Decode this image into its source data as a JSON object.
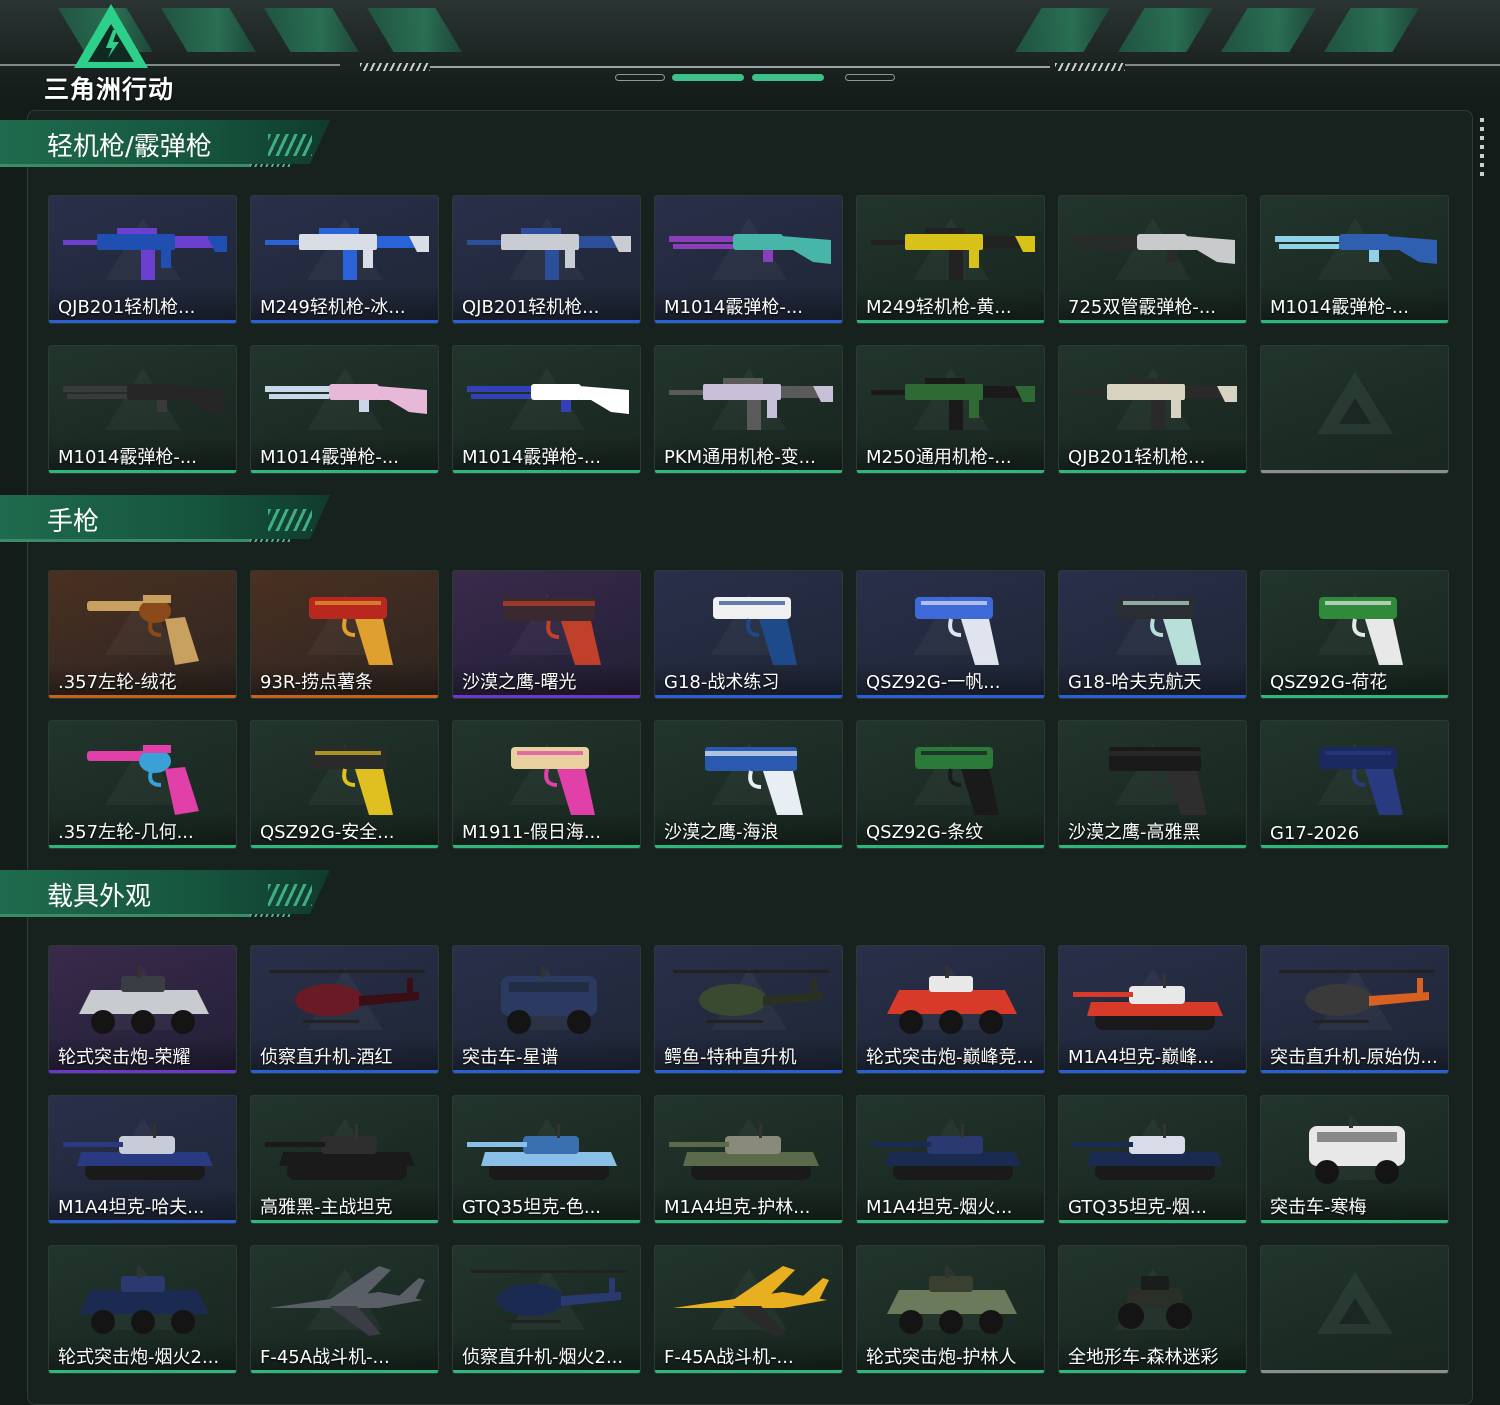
{
  "app": {
    "logo_text": "三角洲行动"
  },
  "colors": {
    "green": "#2fb67a",
    "blue": "#2a5fd6",
    "purple": "#6b38c9",
    "orange": "#c8621c",
    "gray": "#8a8f8d"
  },
  "sections": [
    {
      "title": "轻机枪/霰弹枪",
      "items": [
        {
          "name": "QJB201轻机枪...",
          "rarity": "blue",
          "bg": "blue",
          "kind": "lmg",
          "c1": "#1f4fb0",
          "c2": "#6b3fd0"
        },
        {
          "name": "M249轻机枪-冰...",
          "rarity": "blue",
          "bg": "blue",
          "kind": "lmg",
          "c1": "#d8dde6",
          "c2": "#2a62d8"
        },
        {
          "name": "QJB201轻机枪...",
          "rarity": "blue",
          "bg": "blue",
          "kind": "lmg",
          "c1": "#c9cdd3",
          "c2": "#2d4f9a"
        },
        {
          "name": "M1014霰弹枪-...",
          "rarity": "blue",
          "bg": "blue",
          "kind": "shotgun",
          "c1": "#47b5a8",
          "c2": "#8a3fb8"
        },
        {
          "name": "M249轻机枪-黄...",
          "rarity": "green",
          "bg": "green",
          "kind": "lmg",
          "c1": "#d8c21a",
          "c2": "#222"
        },
        {
          "name": "725双管霰弹枪-...",
          "rarity": "green",
          "bg": "green",
          "kind": "shotgun",
          "c1": "#c8cacc",
          "c2": "#2a2a2a"
        },
        {
          "name": "M1014霰弹枪-...",
          "rarity": "green",
          "bg": "green",
          "kind": "shotgun",
          "c1": "#2e5fb0",
          "c2": "#8fd1e6"
        },
        {
          "name": "M1014霰弹枪-...",
          "rarity": "green",
          "bg": "green",
          "kind": "shotgun",
          "c1": "#262626",
          "c2": "#3a3a3a"
        },
        {
          "name": "M1014霰弹枪-...",
          "rarity": "green",
          "bg": "green",
          "kind": "shotgun",
          "c1": "#e7b8d8",
          "c2": "#c9d8e8"
        },
        {
          "name": "M1014霰弹枪-...",
          "rarity": "green",
          "bg": "green",
          "kind": "shotgun",
          "c1": "#ffffff",
          "c2": "#3440b8"
        },
        {
          "name": "PKM通用机枪-变...",
          "rarity": "green",
          "bg": "green",
          "kind": "lmg",
          "c1": "#c8c0d8",
          "c2": "#5a5a5a"
        },
        {
          "name": "M250通用机枪-...",
          "rarity": "green",
          "bg": "green",
          "kind": "lmg",
          "c1": "#2f6a35",
          "c2": "#1a1a1a"
        },
        {
          "name": "QJB201轻机枪...",
          "rarity": "green",
          "bg": "green",
          "kind": "lmg",
          "c1": "#d8d2c0",
          "c2": "#2a2a2a"
        },
        {
          "name": "",
          "rarity": "gray",
          "bg": "green",
          "kind": "empty",
          "c1": "",
          "c2": ""
        }
      ]
    },
    {
      "title": "手枪",
      "items": [
        {
          "name": ".357左轮-绒花",
          "rarity": "orange",
          "bg": "orange",
          "kind": "revolver",
          "c1": "#c8a060",
          "c2": "#8a4a1a"
        },
        {
          "name": "93R-捞点薯条",
          "rarity": "orange",
          "bg": "orange",
          "kind": "pistol",
          "c1": "#b8281e",
          "c2": "#e0a030"
        },
        {
          "name": "沙漠之鹰-曙光",
          "rarity": "purple",
          "bg": "purple",
          "kind": "deagle",
          "c1": "#3a2a30",
          "c2": "#c0402a"
        },
        {
          "name": "G18-战术练习",
          "rarity": "blue",
          "bg": "blue",
          "kind": "pistol",
          "c1": "#f0f0f0",
          "c2": "#1f4a8a"
        },
        {
          "name": "QSZ92G-一帆...",
          "rarity": "blue",
          "bg": "blue",
          "kind": "pistol",
          "c1": "#3d6ad8",
          "c2": "#e0e4ee"
        },
        {
          "name": "G18-哈夫克航天",
          "rarity": "blue",
          "bg": "blue",
          "kind": "pistol",
          "c1": "#2a2e33",
          "c2": "#b8e0d8"
        },
        {
          "name": "QSZ92G-荷花",
          "rarity": "green",
          "bg": "green",
          "kind": "pistol",
          "c1": "#2f8a3a",
          "c2": "#e8e8e8"
        },
        {
          "name": ".357左轮-几何...",
          "rarity": "green",
          "bg": "green",
          "kind": "revolver",
          "c1": "#e040a8",
          "c2": "#3aa0d8"
        },
        {
          "name": "QSZ92G-安全...",
          "rarity": "green",
          "bg": "green",
          "kind": "pistol",
          "c1": "#2a2a2a",
          "c2": "#e0c020"
        },
        {
          "name": "M1911-假日海...",
          "rarity": "green",
          "bg": "green",
          "kind": "pistol",
          "c1": "#e8d0a0",
          "c2": "#e040a8"
        },
        {
          "name": "沙漠之鹰-海浪",
          "rarity": "green",
          "bg": "green",
          "kind": "deagle",
          "c1": "#2a5ab0",
          "c2": "#e8eef4"
        },
        {
          "name": "QSZ92G-条纹",
          "rarity": "green",
          "bg": "green",
          "kind": "pistol",
          "c1": "#2a7a3a",
          "c2": "#1a1a1a"
        },
        {
          "name": "沙漠之鹰-高雅黑",
          "rarity": "green",
          "bg": "green",
          "kind": "deagle",
          "c1": "#1a1a1a",
          "c2": "#2e2e2e"
        },
        {
          "name": "G17-2026",
          "rarity": "green",
          "bg": "green",
          "kind": "pistol",
          "c1": "#1a2a60",
          "c2": "#2a3a80"
        }
      ]
    },
    {
      "title": "载具外观",
      "items": [
        {
          "name": "轮式突击炮-荣耀",
          "rarity": "purple",
          "bg": "purple",
          "kind": "apc",
          "c1": "#c8ccd0",
          "c2": "#3a3e44"
        },
        {
          "name": "侦察直升机-酒红",
          "rarity": "blue",
          "bg": "blue",
          "kind": "heli",
          "c1": "#6a1a24",
          "c2": "#3a0e14"
        },
        {
          "name": "突击车-星谱",
          "rarity": "blue",
          "bg": "blue",
          "kind": "truck",
          "c1": "#2a3a60",
          "c2": "#1a1e2a"
        },
        {
          "name": "鳄鱼-特种直升机",
          "rarity": "blue",
          "bg": "blue",
          "kind": "heli",
          "c1": "#3a4a30",
          "c2": "#2a3022"
        },
        {
          "name": "轮式突击炮-巅峰竞...",
          "rarity": "blue",
          "bg": "blue",
          "kind": "apc",
          "c1": "#d83a2a",
          "c2": "#e8e8e8"
        },
        {
          "name": "M1A4坦克-巅峰...",
          "rarity": "blue",
          "bg": "blue",
          "kind": "tank",
          "c1": "#d83a2a",
          "c2": "#e8e8e8"
        },
        {
          "name": "突击直升机-原始伪...",
          "rarity": "blue",
          "bg": "blue",
          "kind": "heli",
          "c1": "#3a3a3a",
          "c2": "#d86020"
        },
        {
          "name": "M1A4坦克-哈夫...",
          "rarity": "blue",
          "bg": "blue",
          "kind": "tank",
          "c1": "#2a3a80",
          "c2": "#c8ccd8"
        },
        {
          "name": "高雅黑-主战坦克",
          "rarity": "green",
          "bg": "green",
          "kind": "tank",
          "c1": "#1a1a1a",
          "c2": "#2e2e2e"
        },
        {
          "name": "GTQ35坦克-色...",
          "rarity": "green",
          "bg": "green",
          "kind": "tank",
          "c1": "#8ac0e8",
          "c2": "#3a70b0"
        },
        {
          "name": "M1A4坦克-护林...",
          "rarity": "green",
          "bg": "green",
          "kind": "tank",
          "c1": "#5a6a4a",
          "c2": "#8a8a7a"
        },
        {
          "name": "M1A4坦克-烟火...",
          "rarity": "green",
          "bg": "green",
          "kind": "tank",
          "c1": "#1a2a50",
          "c2": "#2a3a70"
        },
        {
          "name": "GTQ35坦克-烟...",
          "rarity": "green",
          "bg": "green",
          "kind": "tank",
          "c1": "#1a2a50",
          "c2": "#d8dce8"
        },
        {
          "name": "突击车-寒梅",
          "rarity": "green",
          "bg": "green",
          "kind": "truck",
          "c1": "#e8e8e8",
          "c2": "#2a2a2a"
        },
        {
          "name": "轮式突击炮-烟火2...",
          "rarity": "green",
          "bg": "green",
          "kind": "apc",
          "c1": "#1a2a50",
          "c2": "#2a3a70"
        },
        {
          "name": "F-45A战斗机-...",
          "rarity": "green",
          "bg": "green",
          "kind": "jet",
          "c1": "#5a5e66",
          "c2": "#3a3e44"
        },
        {
          "name": "侦察直升机-烟火2...",
          "rarity": "green",
          "bg": "green",
          "kind": "heli",
          "c1": "#1a2a50",
          "c2": "#2a3a70"
        },
        {
          "name": "F-45A战斗机-...",
          "rarity": "green",
          "bg": "green",
          "kind": "jet",
          "c1": "#e8b020",
          "c2": "#2a2a2a"
        },
        {
          "name": "轮式突击炮-护林人",
          "rarity": "green",
          "bg": "green",
          "kind": "apc",
          "c1": "#6a7a5a",
          "c2": "#3a4030"
        },
        {
          "name": "全地形车-森林迷彩",
          "rarity": "green",
          "bg": "green",
          "kind": "atv",
          "c1": "#2a3028",
          "c2": "#1a1e1a"
        },
        {
          "name": "",
          "rarity": "gray",
          "bg": "green",
          "kind": "empty",
          "c1": "",
          "c2": ""
        }
      ]
    }
  ]
}
